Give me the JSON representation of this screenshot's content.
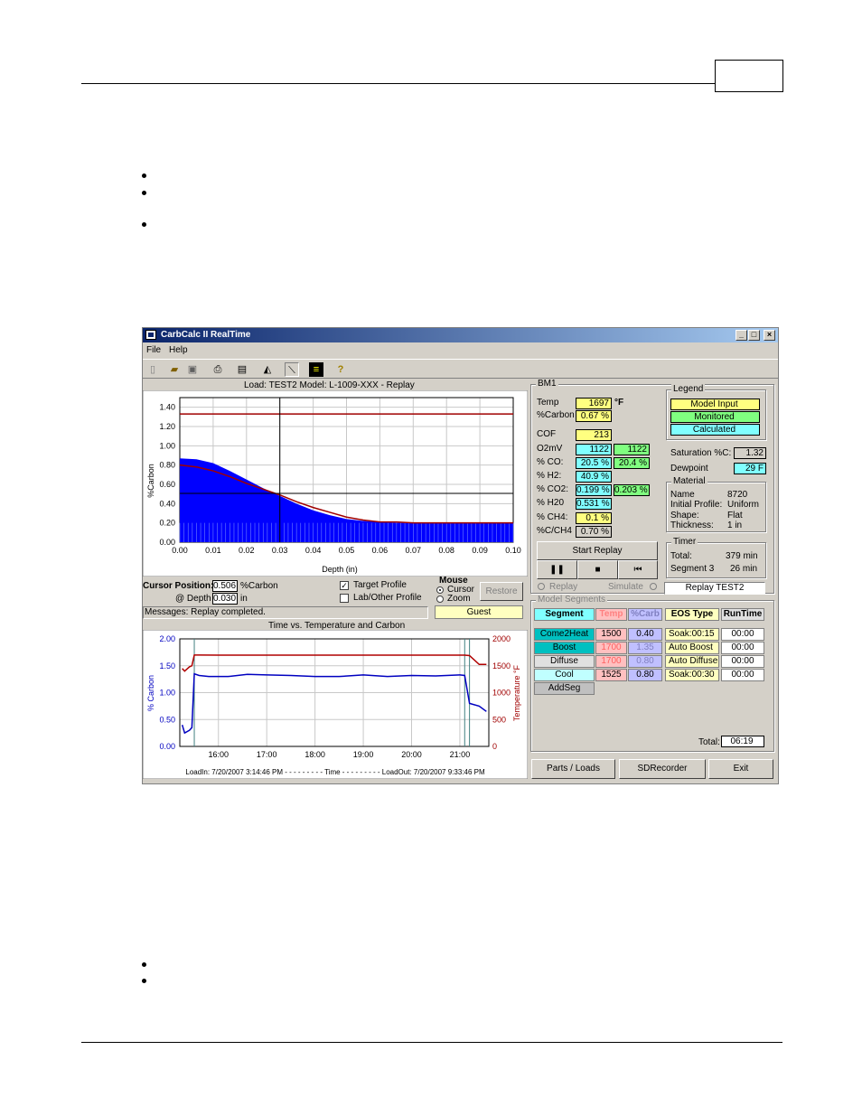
{
  "window": {
    "title": "CarbCalc II RealTime",
    "menu": [
      "File",
      "Help"
    ]
  },
  "toolbar_icons": [
    "new-file-icon",
    "open-folder-icon",
    "save-icon",
    "print-icon",
    "properties-icon",
    "chart-icon",
    "curve-icon",
    "recorder-icon",
    "help-icon"
  ],
  "load_line": "Load:  TEST2    Model:  L-1009-XXX  -  Replay",
  "cursor": {
    "label": "Cursor Position:",
    "carbon": "0.506",
    "carbon_unit": "%Carbon",
    "depth_label": "@ Depth",
    "depth": "0.030",
    "depth_unit": "in"
  },
  "checkboxes": {
    "target_profile": "Target Profile",
    "lab_profile": "Lab/Other Profile"
  },
  "mouse": {
    "title": "Mouse",
    "cursor": "Cursor",
    "zoom": "Zoom",
    "restore": "Restore"
  },
  "messages": "Messages: Replay completed.",
  "user": "Guest",
  "bm1": {
    "title": "BM1",
    "temp": {
      "label": "Temp",
      "value": "1697",
      "unit": "°F"
    },
    "carbon": {
      "label": "%Carbon",
      "value": "0.67 %"
    },
    "cof": {
      "label": "COF",
      "value": "213"
    },
    "o2mv": {
      "label": "O2mV",
      "value": "1122",
      "value2": "1122"
    },
    "co": {
      "label": "% CO:",
      "value": "20.5 %",
      "value2": "20.4 %"
    },
    "h2": {
      "label": "% H2:",
      "value": "40.9 %"
    },
    "co2": {
      "label": "% CO2:",
      "value": "0.199 %",
      "value2": "0.203 %"
    },
    "h2o": {
      "label": "% H20",
      "value": "0.531 %"
    },
    "ch4": {
      "label": "% CH4:",
      "value": "0.1 %"
    },
    "cch4": {
      "label": "%C/CH4",
      "value": "0.70 %"
    }
  },
  "legend": {
    "title": "Legend",
    "model_input": "Model Input",
    "monitored": "Monitored",
    "calculated": "Calculated",
    "yellow": "#ffff80",
    "green": "#80ff80",
    "cyan": "#80ffff"
  },
  "saturation": {
    "label": "Saturation %C:",
    "value": "1.32"
  },
  "dewpoint": {
    "label": "Dewpoint",
    "value": "29 F"
  },
  "material": {
    "title": "Material",
    "rows": [
      [
        "Name",
        "8720"
      ],
      [
        "Initial Profile:",
        "Uniform"
      ],
      [
        "Shape:",
        "Flat"
      ],
      [
        "Thickness:",
        "1 in"
      ]
    ]
  },
  "timer": {
    "title": "Timer",
    "total_label": "Total:",
    "total": "379 min",
    "segment_label": "Segment 3",
    "segment": "26 min"
  },
  "replay": {
    "start": "Start Replay",
    "replay_status": "Replay TEST2",
    "radio_replay": "Replay",
    "radio_simulate": "Simulate"
  },
  "segments": {
    "title": "Model Segments",
    "headers": [
      "Segment",
      "Temp",
      "%Carb",
      "EOS Type",
      "RunTime"
    ],
    "rows": [
      {
        "name": "Come2Heat",
        "temp": "1500",
        "carb": "0.40",
        "eos": "Soak:00:15",
        "runtime": "00:00"
      },
      {
        "name": "Boost",
        "temp": "1700",
        "carb": "1.35",
        "eos": "Auto Boost",
        "runtime": "00:00"
      },
      {
        "name": "Diffuse",
        "temp": "1700",
        "carb": "0.80",
        "eos": "Auto Diffuse",
        "runtime": "00:00"
      },
      {
        "name": "Cool",
        "temp": "1525",
        "carb": "0.80",
        "eos": "Soak:00:30",
        "runtime": "00:00"
      }
    ],
    "add": "AddSeg",
    "total_label": "Total:",
    "total": "06:19"
  },
  "buttons": {
    "parts": "Parts / Loads",
    "sd": "SDRecorder",
    "exit": "Exit"
  },
  "chart_data": [
    {
      "type": "area",
      "title": "",
      "xlabel": "Depth (in)",
      "ylabel": "%Carbon",
      "xlim": [
        0,
        0.1
      ],
      "ylim": [
        0,
        1.5
      ],
      "x_ticks": [
        "0.00",
        "0.01",
        "0.02",
        "0.03",
        "0.04",
        "0.05",
        "0.06",
        "0.07",
        "0.08",
        "0.09",
        "0.10"
      ],
      "y_ticks": [
        "0.00",
        "0.20",
        "0.40",
        "0.60",
        "0.80",
        "1.00",
        "1.20",
        "1.40"
      ],
      "series": [
        {
          "values_x": [
            0,
            0.005,
            0.01,
            0.015,
            0.02,
            0.025,
            0.03,
            0.035,
            0.04,
            0.045,
            0.05,
            0.055,
            0.06,
            0.065,
            0.07,
            0.08,
            0.09,
            0.1
          ],
          "values_y": [
            0.87,
            0.86,
            0.82,
            0.74,
            0.65,
            0.56,
            0.48,
            0.4,
            0.33,
            0.28,
            0.24,
            0.22,
            0.21,
            0.2,
            0.2,
            0.2,
            0.2,
            0.2
          ]
        },
        {
          "values_x": [
            0,
            0.005,
            0.01,
            0.015,
            0.02,
            0.025,
            0.03,
            0.035,
            0.04,
            0.045,
            0.05,
            0.055,
            0.06,
            0.065,
            0.07,
            0.08,
            0.09,
            0.1
          ],
          "values_y": [
            0.8,
            0.78,
            0.74,
            0.68,
            0.61,
            0.55,
            0.49,
            0.42,
            0.36,
            0.31,
            0.26,
            0.23,
            0.21,
            0.21,
            0.2,
            0.2,
            0.2,
            0.2
          ]
        },
        {
          "values_x": [
            0,
            0.1
          ],
          "values_y": [
            1.33,
            1.33
          ]
        },
        {
          "values_x": [
            0,
            0.1
          ],
          "values_y": [
            0.2,
            0.2
          ]
        }
      ],
      "cursor": {
        "x": 0.03,
        "y": 0.506
      }
    },
    {
      "type": "line",
      "title": "Time vs. Temperature and Carbon",
      "xlabel": "LoadIn: 7/20/2007 3:14:46 PM - - - - - - - - - Time - - - - - - - - - LoadOut: 7/20/2007 9:33:46 PM",
      "ylabel": "% Carbon",
      "ylabel2": "Temperature °F",
      "xlim": [
        15.2,
        21.6
      ],
      "ylim": [
        0,
        2
      ],
      "ylim2": [
        0,
        2000
      ],
      "x_ticks": [
        "16:00",
        "17:00",
        "18:00",
        "19:00",
        "20:00",
        "21:00"
      ],
      "y_ticks": [
        "0.00",
        "0.50",
        "1.00",
        "1.50",
        "2.00"
      ],
      "y2_ticks": [
        "0",
        "500",
        "1000",
        "1500",
        "2000"
      ],
      "series": [
        {
          "values_x": [
            15.25,
            15.3,
            15.4,
            15.45,
            15.5,
            15.6,
            15.8,
            16.2,
            16.6,
            17.0,
            17.5,
            18.0,
            18.5,
            19.0,
            19.5,
            20.0,
            20.5,
            21.0,
            21.1,
            21.2,
            21.4,
            21.55
          ],
          "values_y": [
            0.4,
            0.25,
            0.3,
            0.35,
            1.35,
            1.32,
            1.3,
            1.3,
            1.34,
            1.33,
            1.32,
            1.3,
            1.3,
            1.33,
            1.3,
            1.32,
            1.31,
            1.33,
            1.32,
            0.8,
            0.75,
            0.65
          ]
        },
        {
          "values_x": [
            15.25,
            15.3,
            15.4,
            15.45,
            15.5,
            15.6,
            16.0,
            17.0,
            18.0,
            19.0,
            20.0,
            21.0,
            21.1,
            21.2,
            21.4,
            21.55
          ],
          "values_y": [
            1450,
            1400,
            1480,
            1500,
            1700,
            1700,
            1697,
            1697,
            1697,
            1697,
            1697,
            1697,
            1697,
            1690,
            1525,
            1525
          ]
        }
      ],
      "markers_x": [
        15.5,
        21.1,
        21.2
      ]
    }
  ]
}
